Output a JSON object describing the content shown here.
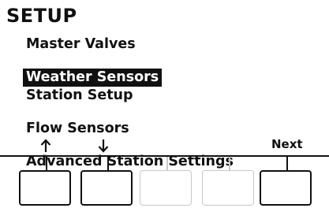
{
  "screen": {
    "title": "SETUP",
    "menu_items": [
      {
        "label": "Master Valves",
        "selected": false
      },
      {
        "label": "Weather Sensors",
        "selected": true
      },
      {
        "label": "Station Setup",
        "selected": false
      },
      {
        "label": "Flow Sensors",
        "selected": false
      },
      {
        "label": "Advanced Station Settings",
        "selected": false
      }
    ]
  },
  "softkeys": {
    "key1_icon": "up-arrow-icon",
    "key2_icon": "down-arrow-icon",
    "key5_label": "Next"
  },
  "colors": {
    "ink": "#111111",
    "inactive": "#c8c8c8",
    "background": "#ffffff"
  }
}
